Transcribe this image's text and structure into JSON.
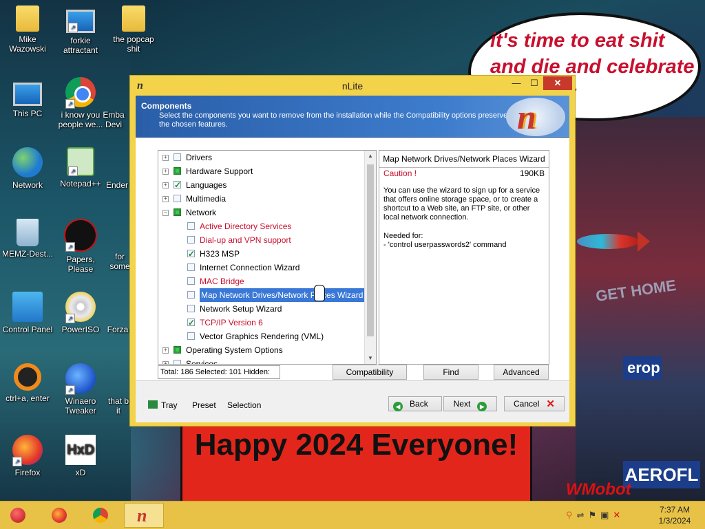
{
  "desktop": {
    "icons": [
      {
        "label": "Mike Wazowski",
        "icon": "folder-icon"
      },
      {
        "label": "forkie attractant",
        "icon": "settings-pc-icon"
      },
      {
        "label": "the popcap shit",
        "icon": "folder-icon"
      },
      {
        "label": "This PC",
        "icon": "computer-icon"
      },
      {
        "label": "i know you people we...",
        "icon": "chrome-icon"
      },
      {
        "label": "Emba Devi",
        "icon": "shortcut-icon"
      },
      {
        "label": "Network",
        "icon": "network-icon"
      },
      {
        "label": "Notepad++",
        "icon": "notepadpp-icon"
      },
      {
        "label": "Ender",
        "icon": "shortcut-icon"
      },
      {
        "label": "MEMZ-Dest...",
        "icon": "recycle-bin-icon"
      },
      {
        "label": "Papers, Please",
        "icon": "papers-please-icon"
      },
      {
        "label": "for some",
        "icon": "shortcut-icon"
      },
      {
        "label": "Control Panel",
        "icon": "control-panel-icon"
      },
      {
        "label": "PowerISO",
        "icon": "poweriso-icon"
      },
      {
        "label": "Forza",
        "icon": "shortcut-icon"
      },
      {
        "label": "ctrl+a, enter",
        "icon": "ring-icon"
      },
      {
        "label": "Winaero Tweaker",
        "icon": "winaero-icon"
      },
      {
        "label": "that b it",
        "icon": "shortcut-icon"
      },
      {
        "label": "Firefox",
        "icon": "firefox-icon"
      },
      {
        "label": "xD",
        "icon": "hxd-icon"
      }
    ],
    "speech_text": "it's time to eat shit and die and celebrate new year",
    "banner_text": "Happy 2024 Everyone!",
    "sign_get_home": "GET HOME",
    "sign_europ": "erop",
    "sign_aeroflot": "AEROFL",
    "watermark": "WMobot"
  },
  "window": {
    "title": "nLite",
    "controls": {
      "minimize": "—",
      "maximize": "☐",
      "close": "✕"
    },
    "header": {
      "heading": "Components",
      "description": "Select the components you want to remove from the installation while the Compatibility options preserve the chosen features."
    },
    "tree": [
      {
        "label": "Drivers",
        "state": "empty",
        "expander": "+",
        "level": 0,
        "red": false
      },
      {
        "label": "Hardware Support",
        "state": "full",
        "expander": "+",
        "level": 0,
        "red": false
      },
      {
        "label": "Languages",
        "state": "checked",
        "expander": "+",
        "level": 0,
        "red": false
      },
      {
        "label": "Multimedia",
        "state": "empty",
        "expander": "+",
        "level": 0,
        "red": false
      },
      {
        "label": "Network",
        "state": "full",
        "expander": "−",
        "level": 0,
        "red": false
      },
      {
        "label": "Active Directory Services",
        "state": "empty",
        "level": 1,
        "red": true
      },
      {
        "label": "Dial-up and VPN support",
        "state": "empty",
        "level": 1,
        "red": true
      },
      {
        "label": "H323 MSP",
        "state": "checked",
        "level": 1,
        "red": false
      },
      {
        "label": "Internet Connection Wizard",
        "state": "empty",
        "level": 1,
        "red": false
      },
      {
        "label": "MAC Bridge",
        "state": "empty",
        "level": 1,
        "red": true
      },
      {
        "label": "Map Network Drives/Network Places Wizard",
        "state": "empty",
        "level": 1,
        "red": false,
        "selected": true
      },
      {
        "label": "Network Setup Wizard",
        "state": "empty",
        "level": 1,
        "red": false
      },
      {
        "label": "TCP/IP Version 6",
        "state": "checked",
        "level": 1,
        "red": true
      },
      {
        "label": "Vector Graphics Rendering (VML)",
        "state": "empty",
        "level": 1,
        "red": false
      },
      {
        "label": "Operating System Options",
        "state": "full",
        "expander": "+",
        "level": 0,
        "red": false
      },
      {
        "label": "Services",
        "state": "empty",
        "expander": "+",
        "level": 0,
        "red": false
      }
    ],
    "info": {
      "title": "Map Network Drives/Network Places Wizard",
      "caution": "Caution !",
      "size": "190KB",
      "description": "You can use the wizard to sign up for a service that offers online storage space, or to create a shortcut to a Web site, an FTP site, or other local network connection.",
      "needed_for_label": "Needed for:",
      "needed_for_item": " - 'control userpasswords2' command"
    },
    "status": "Total: 186 Selected: 101 Hidden: 35",
    "buttons": {
      "compatibility": "Compatibility",
      "find": "Find",
      "advanced": "Advanced"
    },
    "footer": {
      "tray": "Tray",
      "preset": "Preset",
      "selection": "Selection",
      "back": "Back",
      "next": "Next",
      "cancel": "Cancel"
    }
  },
  "taskbar": {
    "apps": [
      "ornament-start-icon",
      "firefox-icon",
      "chrome-icon",
      "nlite-icon"
    ],
    "tray_icons": [
      "search-icon",
      "network-icon",
      "flag-icon",
      "power-icon",
      "volume-muted-icon"
    ],
    "time": "7:37 AM",
    "date": "1/3/2024"
  },
  "colors": {
    "window_frame": "#f3d34a",
    "header_blue": "#2a5ea8",
    "accent_red": "#c8102e",
    "taskbar": "#e8c246"
  }
}
